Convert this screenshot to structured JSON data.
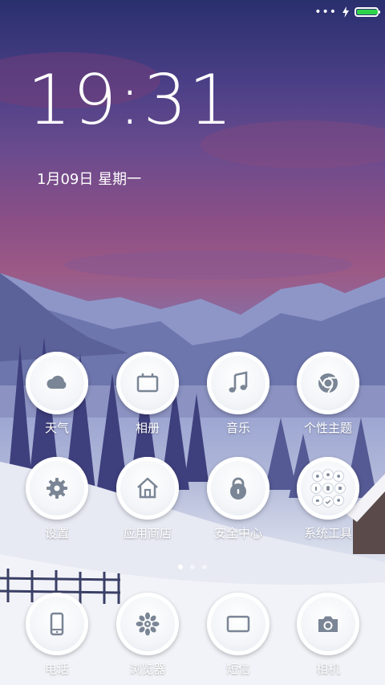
{
  "status_bar": {
    "signal_icon": "more-dots-icon",
    "charging_icon": "lightning-icon",
    "battery_level": 1.0,
    "battery_color": "#2fd34a"
  },
  "lockscreen": {
    "time": "19:31",
    "date": "1月09日 星期一"
  },
  "apps_row1": [
    {
      "label": "天气",
      "icon": "cloud-icon"
    },
    {
      "label": "相册",
      "icon": "gallery-icon"
    },
    {
      "label": "音乐",
      "icon": "music-note-icon"
    },
    {
      "label": "个性主题",
      "icon": "chrome-theme-icon"
    }
  ],
  "apps_row2": [
    {
      "label": "设置",
      "icon": "gear-icon"
    },
    {
      "label": "应用商店",
      "icon": "home-store-icon"
    },
    {
      "label": "安全中心",
      "icon": "lock-icon"
    },
    {
      "label": "系统工具",
      "icon": "tools-folder-icon"
    }
  ],
  "pager": {
    "pages": 3,
    "active": 1
  },
  "dock": [
    {
      "label": "电话",
      "icon": "phone-icon"
    },
    {
      "label": "浏览器",
      "icon": "browser-icon"
    },
    {
      "label": "短信",
      "icon": "message-icon"
    },
    {
      "label": "相机",
      "icon": "camera-icon"
    }
  ],
  "colors": {
    "icon_gray": "#7a8595",
    "accent": "#2fd34a"
  }
}
